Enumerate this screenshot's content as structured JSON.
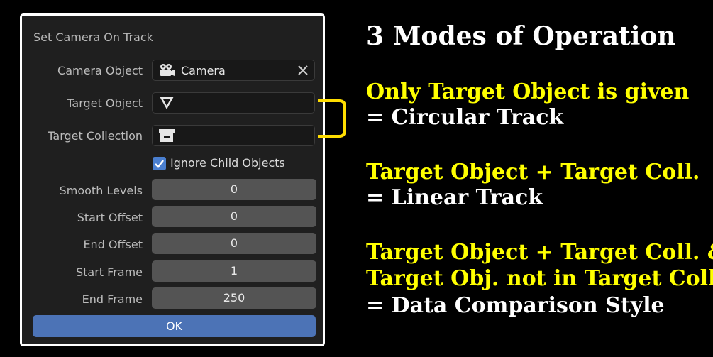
{
  "dialog": {
    "title": "Set Camera On Track",
    "camera_object": {
      "label": "Camera Object",
      "value": "Camera",
      "icon": "camera-icon"
    },
    "target_object": {
      "label": "Target Object",
      "value": "",
      "icon": "mesh-triangle-icon"
    },
    "target_collection": {
      "label": "Target Collection",
      "value": "",
      "icon": "collection-box-icon"
    },
    "ignore_child": {
      "label": "Ignore Child Objects",
      "checked": true
    },
    "smooth_levels": {
      "label": "Smooth Levels",
      "value": "0"
    },
    "start_offset": {
      "label": "Start Offset",
      "value": "0"
    },
    "end_offset": {
      "label": "End Offset",
      "value": "0"
    },
    "start_frame": {
      "label": "Start Frame",
      "value": "1"
    },
    "end_frame": {
      "label": "End Frame",
      "value": "250"
    },
    "ok_label": "OK"
  },
  "panel": {
    "heading": "3 Modes of Operation",
    "modes": [
      {
        "conditions": [
          "Only Target Object is given"
        ],
        "result": "= Circular Track"
      },
      {
        "conditions": [
          "Target Object + Target Coll."
        ],
        "result": "= Linear Track"
      },
      {
        "conditions": [
          "Target Object + Target Coll. &",
          "Target Obj. not in Target Coll."
        ],
        "result": "= Data Comparison Style"
      }
    ]
  },
  "colors": {
    "highlight": "#ffff00",
    "accent_blue": "#4c73b6",
    "dialog_bg": "#1f1f1f",
    "bracket": "#ffdd00"
  }
}
